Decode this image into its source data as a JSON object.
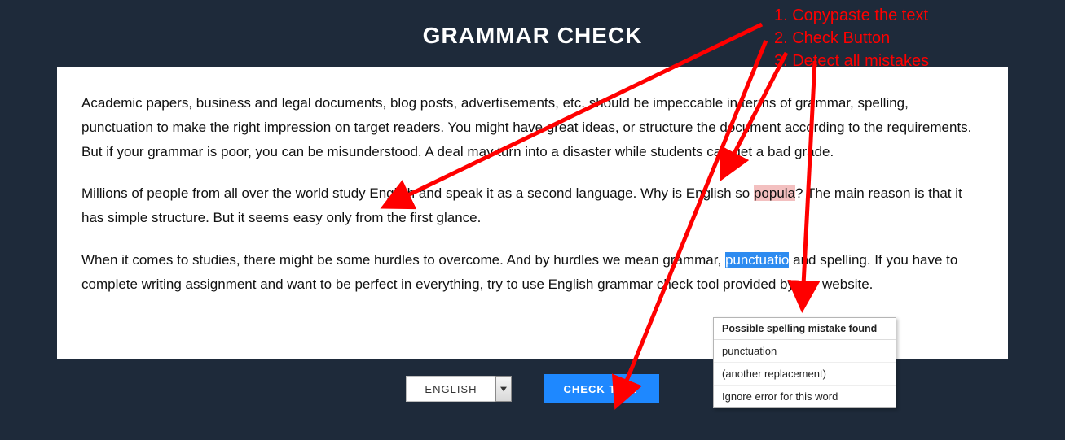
{
  "title": "GRAMMAR CHECK",
  "paragraphs": {
    "p1": "Academic papers, business and legal documents, blog posts, advertisements, etc. should be impeccable in terms of grammar, spelling, punctuation to make the right impression on target readers. You might have great ideas, or structure the document according to the requirements. But if your grammar is poor, you can be misunderstood. A deal may turn into a disaster while students can get a bad grade.",
    "p2a": "Millions of people from all over the world study English and speak it as a second language. Why is English so ",
    "p2_err": "popula",
    "p2b": "? The main reason is that it has simple structure. But it seems easy only from the first glance.",
    "p3a": "When it comes to studies, there might be some hurdles to overcome. And by hurdles we mean grammar, ",
    "p3_err": "punctuatio",
    "p3b": " and spelling. If you have to complete writing assignment and want to be perfect in everything, try to use English grammar check tool provided by our website."
  },
  "language": {
    "selected": "ENGLISH"
  },
  "check_button": "CHECK TEXT",
  "popup": {
    "title": "Possible spelling mistake found",
    "items": [
      "punctuation",
      "(another replacement)",
      "Ignore error for this word"
    ]
  },
  "annotations": {
    "a1": "1. Copypaste the text",
    "a2": "2. Check Button",
    "a3": "3. Detect all mistakes"
  }
}
